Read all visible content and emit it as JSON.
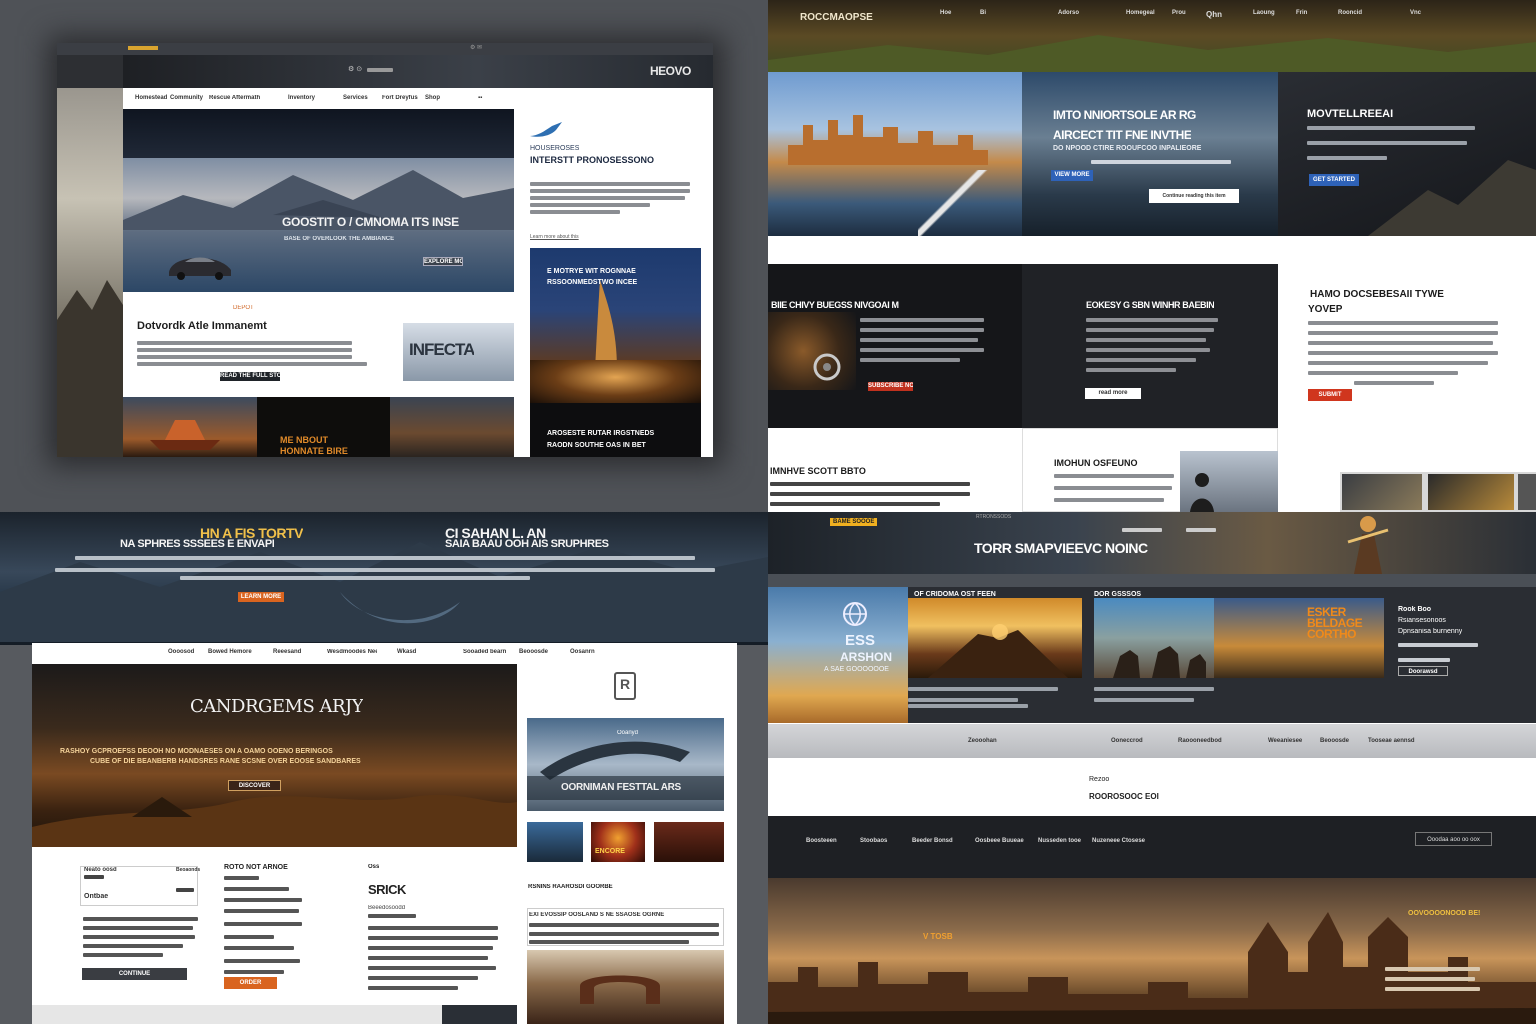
{
  "q1": {
    "brand": "HEOVO",
    "topbar_icons": "⚙ ✉",
    "nav": [
      "Homestead",
      "Community",
      "Rescue Aftermath",
      "Inventory",
      "Services",
      "Fort Dreyfuss Sequels",
      "Shop"
    ],
    "hero_headline": "GOOSTIT O / CMNOMA ITS INSE",
    "hero_sub": "BASE OF OVERLOOK THE AMBIANCE",
    "hero_btn": "EXPLORE MORE",
    "side_title1": "HOUSEROSES",
    "side_title2": "INTERSTT PRONOSESSONO",
    "side_link": "Learn more about this",
    "side_card_text1": "E MOTRYE WIT ROGNNAE",
    "side_card_text2": "RSSOONMEDSTWO INCEE",
    "side_card_bottom1": "AROSESTE RUTAR IRGSTNEDS",
    "side_card_bottom2": "RAODN SOUTHE OAS IN BET",
    "eyebrow": "DEPOT",
    "section_title": "Dotvordk Atle Immanemt",
    "section_btn": "READ THE FULL STORY",
    "sign_text": "INFECTA",
    "thumb_caption1": "ME NBOUT",
    "thumb_caption2": "HONNATE BIRE"
  },
  "q2": {
    "brand": "ROCCMAOPSE",
    "nav": [
      "Hoe",
      "Bi",
      "Adorso",
      "Homegeal",
      "Prou",
      "Qhn",
      "Laoung",
      "Frin",
      "Rooncid",
      "Vnc"
    ],
    "hero1_title1": "IMTO NNIORTSOLE AR RG",
    "hero1_title2": "AIRCECT TIT FNE INVTHE",
    "hero1_sub": "DO NPOOD CTIRE ROOUFCOO INPALIEORE",
    "hero1_btn": "VIEW MORE",
    "hero1_btn2": "Continue reading this item",
    "hero2_title": "MOVTELLREEAI",
    "hero2_btn": "GET STARTED",
    "row2_left_title": "BIIE CHIVY BUEGSS NIVGOAI M",
    "row2_mid_title": "EOKESY G SBN WINHR BAEBIN",
    "row2_mid_btn": "read more",
    "row2_left_btn": "SUBSCRIBE NOW",
    "row2_right_title1": "HAMO DOCSEBESAII TYWE",
    "row2_right_title2": "YOVEP",
    "row2_right_btn": "SUBMIT",
    "row3_left_title": "IMNHVE SCOTT BBTO",
    "row3_mid_title": "IMOHUN OSFEUNO"
  },
  "q3": {
    "hero_title_left1": "HN A FIS TORTV",
    "hero_title_left2": "NA SPHRES SSSEES E ENVAPI",
    "hero_title_right1": "CI SAHAN L. AN",
    "hero_title_right2": "SAIA BAAU OOH AIS SRUPHRES",
    "hero_btn": "LEARN MORE",
    "nav": [
      "Oooosod",
      "Bowed Hemore",
      "Reeesand",
      "Wesdmoodes Neeeeonaa",
      "Wkasd",
      "Sooaded bearn",
      "Beooosde",
      "Oosanrn"
    ],
    "main_title": "CANDRGEMS ARJY",
    "main_desc1": "RASHOY GCPROEFSS DEOOH NO MODNAESES ON A OAMO OOENO BERINGOS",
    "main_desc2": "CUBE OF DIE BEANBERB HANDSRES RANE SCSNE OVER EOOSE SANDBARES",
    "main_btn": "DISCOVER",
    "logo_glyph": "R",
    "promo_small": "Ooanyd",
    "promo_caption": "OORNIMAN FESTTAL ARS",
    "thumb_label": "ENCORE",
    "col1_title": "Neato oosd",
    "col1_side": "Beoaonds",
    "col1_sub": "Ontbae",
    "col1_btn": "CONTINUE",
    "col2_title": "ROTO NOT ARNOE",
    "col2_btn": "ORDER",
    "col3_label": "Oss",
    "col3_big": "SRICK",
    "col3_sub": "Beeedosoodd",
    "col4_title": "RSNINS RAAROSDI GOORBE",
    "col4_sub": "EXI EVOSSIP OOSLAND S NE SSAOSE OGRNE"
  },
  "q4": {
    "badge": "BAME SOOOE",
    "hero_small": "RTRONSSODS",
    "hero_title": "TORR SMAPVIEEVC NOINC",
    "logo_line1": "ESS",
    "logo_line2": "ARSHON",
    "logo_line3": "A SAE GOOOOOOE",
    "card1_title": "OF CRIDOMA OST FEEN",
    "card2_title": "DOR GSSSOS",
    "poster_text": "ESKER BELDAGE CORTHO",
    "side_text1": "Rook Boo",
    "side_text2": "Rsiansesonoos",
    "side_text3": "Dpnsanisa burnenny",
    "side_btn": "Doorawsd",
    "gray_nav": [
      "Zeooohan",
      "Ooneccrod",
      "Raoooneedbod",
      "Weeaniesee",
      "Beooosde",
      "Tooseae aennsd"
    ],
    "white_label": "Rezoo",
    "white_sub": "ROOROSOOC EOI",
    "dark_nav": [
      "Boosteeen",
      "Stoobaos",
      "Beeder Bonsd",
      "Oosbeee Buueae",
      "Nusseden tooe",
      "Nuzeneee Ctosese"
    ],
    "dark_btn": "Ooodaa aoo oo oox",
    "bottom_text1": "V TOSB",
    "bottom_text2": "OOVOOOONOOD BE!"
  }
}
